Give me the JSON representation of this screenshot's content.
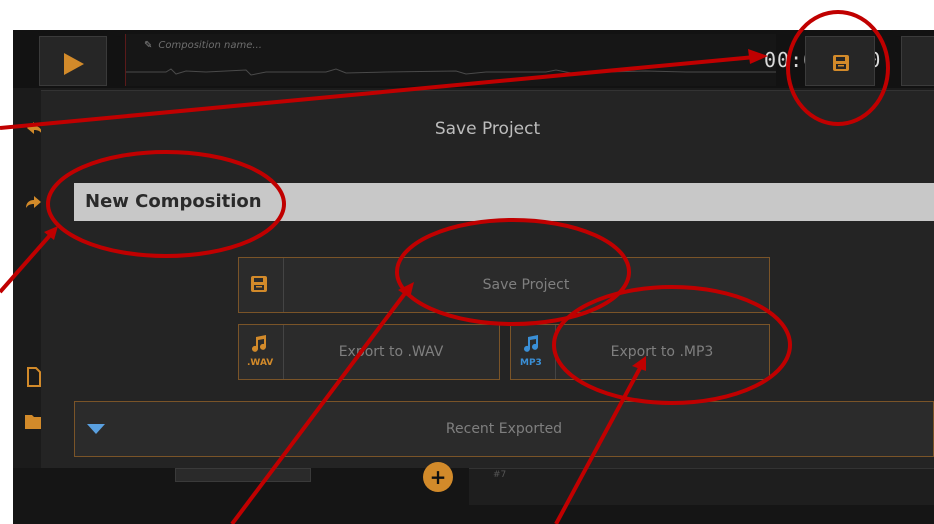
{
  "top_bar": {
    "composition_placeholder": "Composition name...",
    "timer": "00:00:000",
    "play_icon": "play-icon",
    "save_icon": "floppy-save-icon"
  },
  "left_rail": {
    "icons": [
      "undo-icon",
      "redo-icon",
      "new-file-icon",
      "folder-icon",
      "home-icon"
    ]
  },
  "modal": {
    "title": "Save Project",
    "name_value": "New Composition",
    "save_button_label": "Save Project",
    "wav_button_label": "Export to .WAV",
    "wav_badge": ".WAV",
    "mp3_button_label": "Export to .MP3",
    "mp3_badge": "MP3",
    "recent_label": "Recent Exported"
  },
  "bottom": {
    "track_number": "#7"
  },
  "colors": {
    "accent_orange": "#d28a2a",
    "button_border": "#7a5428",
    "annotation_red": "#c00000",
    "mp3_blue": "#3a8fd6",
    "dropdown_blue": "#5aa0e0"
  }
}
